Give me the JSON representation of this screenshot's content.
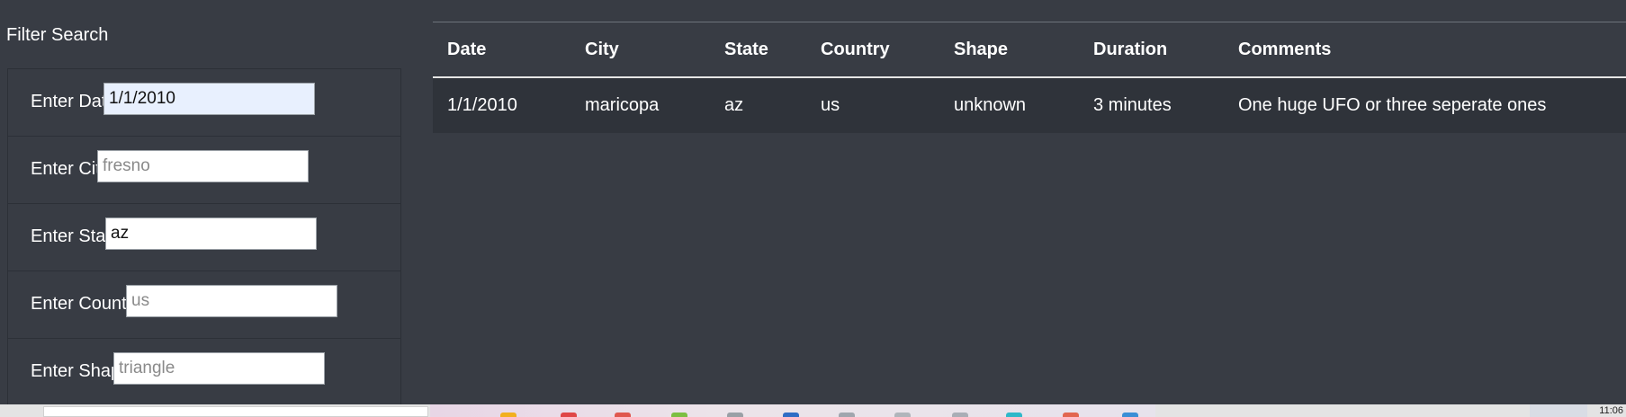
{
  "sidebar": {
    "title": "Filter Search",
    "filters": [
      {
        "label": "Enter Date",
        "value": "1/1/2010",
        "placeholder": "1/1/2010"
      },
      {
        "label": "Enter City",
        "value": "",
        "placeholder": "fresno"
      },
      {
        "label": "Enter State",
        "value": "az",
        "placeholder": ""
      },
      {
        "label": "Enter Country",
        "value": "",
        "placeholder": "us"
      },
      {
        "label": "Enter Shape",
        "value": "",
        "placeholder": "triangle"
      }
    ]
  },
  "table": {
    "headers": [
      "Date",
      "City",
      "State",
      "Country",
      "Shape",
      "Duration",
      "Comments"
    ],
    "rows": [
      [
        "1/1/2010",
        "maricopa",
        "az",
        "us",
        "unknown",
        "3 minutes",
        "One huge UFO or three seperate ones"
      ]
    ]
  },
  "taskbar": {
    "clock": "11:06",
    "icons": [
      {
        "name": "chrome-icon",
        "color": "#f2b01e"
      },
      {
        "name": "record-icon",
        "color": "#e04646"
      },
      {
        "name": "pdf-icon",
        "color": "#e0584f"
      },
      {
        "name": "excel-icon",
        "color": "#7cbf42"
      },
      {
        "name": "explorer-icon",
        "color": "#9aa0a6"
      },
      {
        "name": "word-icon",
        "color": "#2f6dc5"
      },
      {
        "name": "mail-icon",
        "color": "#a0a6ae"
      },
      {
        "name": "calculator-icon",
        "color": "#b0b5bb"
      },
      {
        "name": "snip-icon",
        "color": "#a9aeb6"
      },
      {
        "name": "edge-icon",
        "color": "#2fb8c9"
      },
      {
        "name": "git-icon",
        "color": "#e2664f"
      },
      {
        "name": "vscode-icon",
        "color": "#3b8fd6"
      }
    ]
  },
  "colors": {
    "background": "#383c44",
    "row_background": "#2f333a",
    "autofill": "#e8f0fe"
  }
}
